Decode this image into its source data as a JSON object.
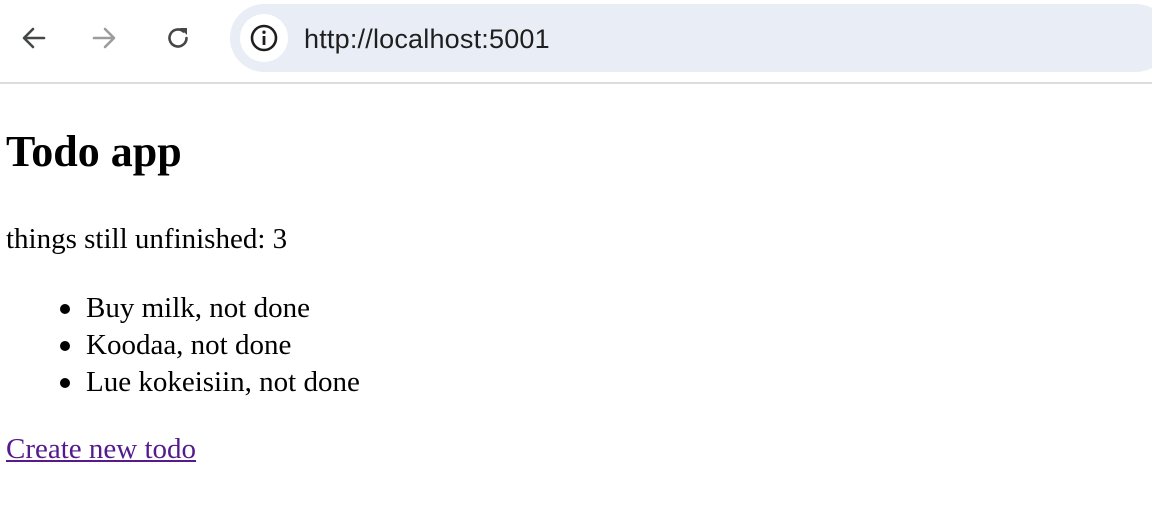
{
  "browser": {
    "url": "http://localhost:5001",
    "icons": {
      "back": "arrow-left-icon",
      "forward": "arrow-right-icon",
      "reload": "reload-icon",
      "site_info": "info-icon"
    }
  },
  "page": {
    "title": "Todo app",
    "unfinished_text": "things still unfinished: 3",
    "todos": [
      {
        "text": "Buy milk, not done"
      },
      {
        "text": "Koodaa, not done"
      },
      {
        "text": "Lue kokeisiin, not done"
      }
    ],
    "create_link": "Create new todo",
    "link_color": "#551a8b"
  }
}
